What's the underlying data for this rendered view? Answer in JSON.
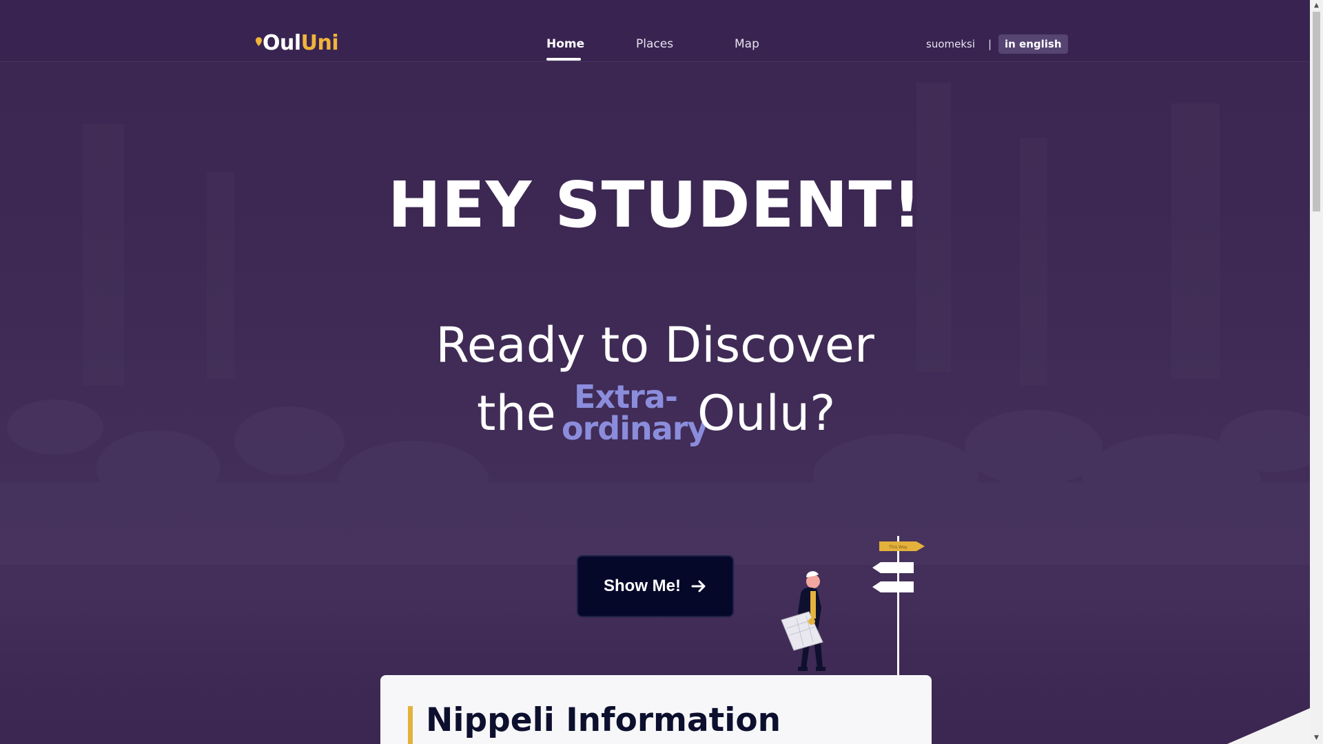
{
  "logo": {
    "part1": "Oul",
    "part2": "Uni"
  },
  "nav": {
    "home": "Home",
    "places": "Places",
    "map": "Map",
    "lang_fi": "suomeksi",
    "lang_sep": "|",
    "lang_en": "in english"
  },
  "hero": {
    "title": "HEY STUDENT!",
    "line1": "Ready to Discover",
    "the": "the",
    "extra1": "Extra-",
    "extra2": "ordinary",
    "oulu": "Oulu?",
    "button": "Show Me!",
    "sign_text": "This Way"
  },
  "info": {
    "title": "Nippeli Information"
  },
  "colors": {
    "background": "#3c2752",
    "accent": "#f1b43a",
    "highlight": "#8b8ddc",
    "button": "#06082a"
  },
  "icons": {
    "logo_pin": "map-pin-icon",
    "button_arrow": "arrow-right-icon"
  }
}
